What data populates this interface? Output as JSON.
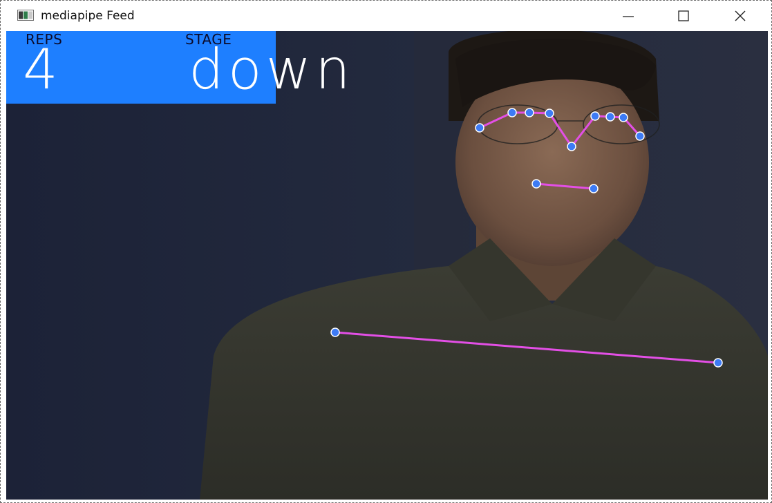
{
  "window": {
    "title": "mediapipe Feed",
    "icon": "app-window-icon",
    "controls": [
      "minimize-icon",
      "maximize-icon",
      "close-icon"
    ]
  },
  "overlay": {
    "reps_label": "REPS",
    "reps_value": "4",
    "stage_label": "STAGE",
    "stage_value": "down",
    "box_color": "#1e7fff",
    "label_color": "#0b0b2a",
    "value_color": "#ffffff"
  },
  "landmarks": {
    "point_color": "#3d7bf5",
    "connection_color": "#e34fe6"
  }
}
